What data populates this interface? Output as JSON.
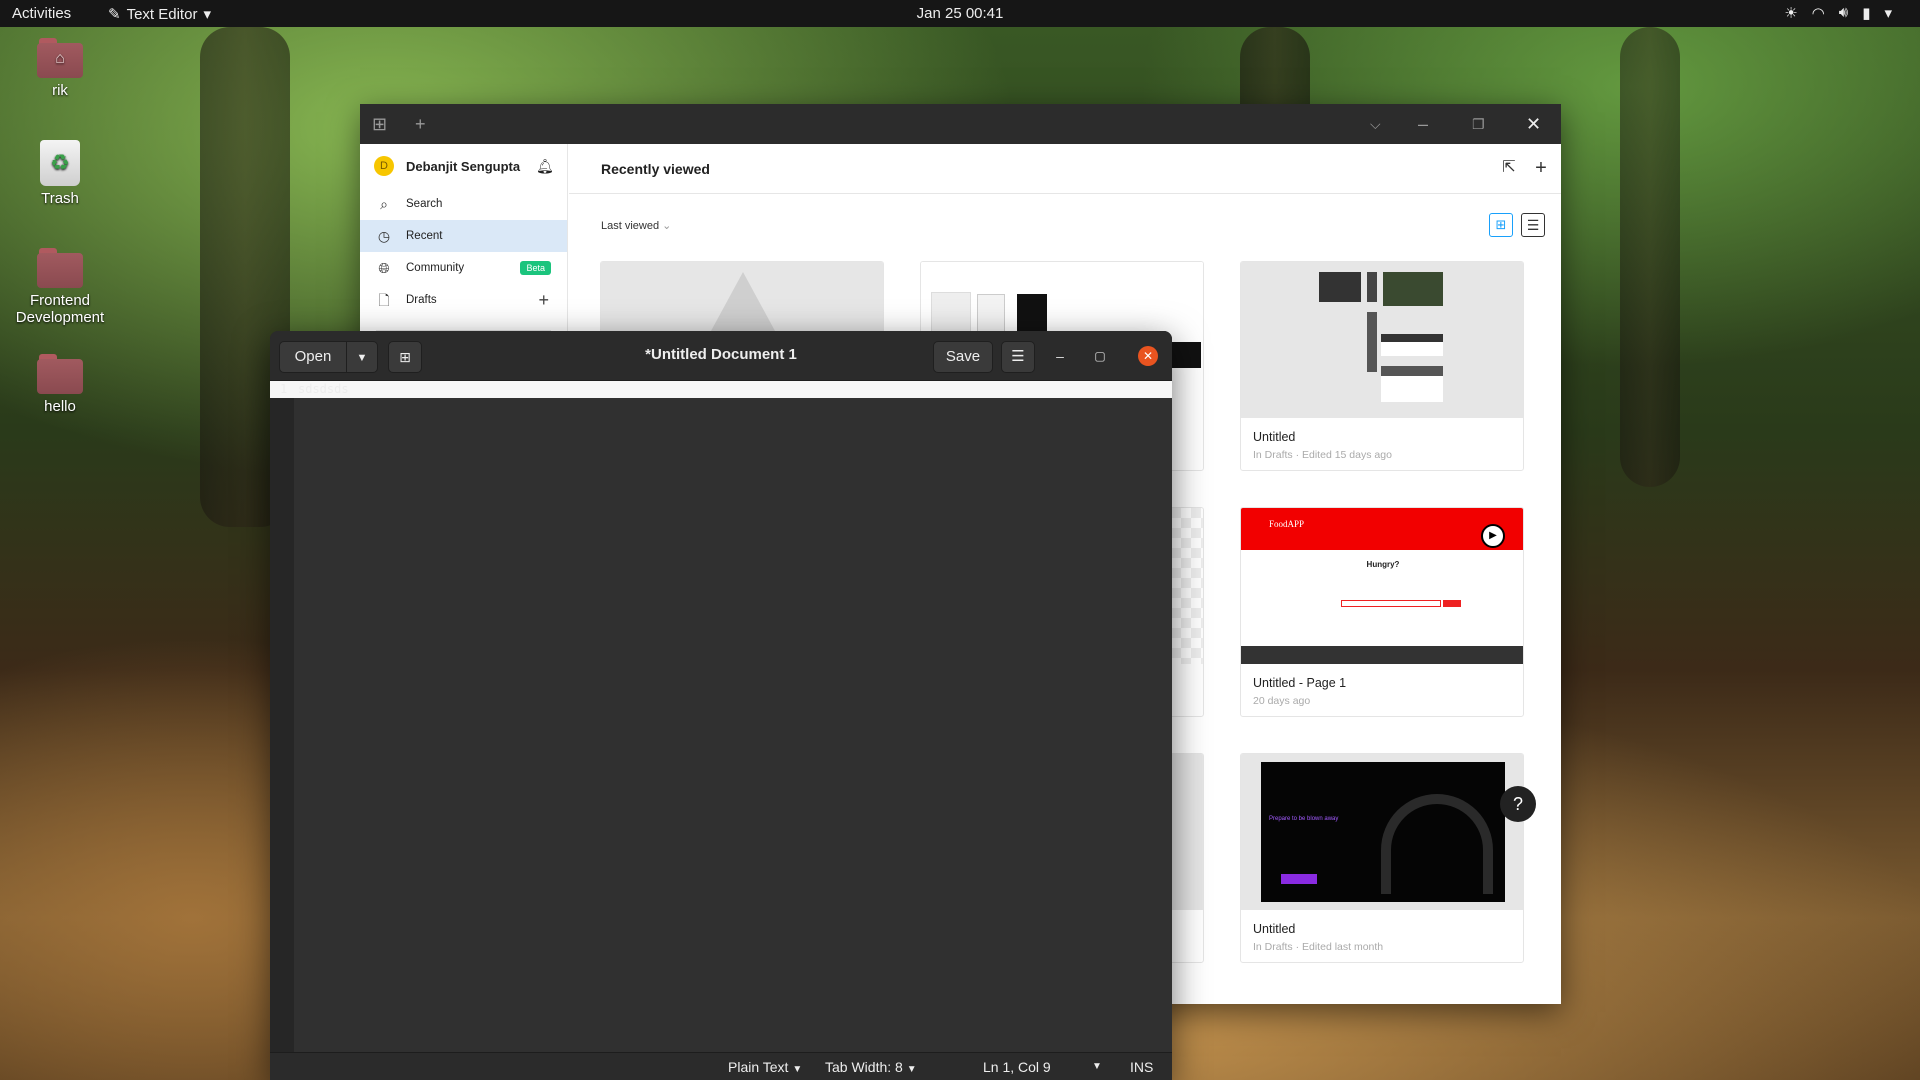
{
  "topbar": {
    "activities": "Activities",
    "app_name": "Text Editor",
    "clock": "Jan 25  00:41"
  },
  "desktop": {
    "icons": [
      {
        "label": "rik"
      },
      {
        "label": "Trash"
      },
      {
        "label": "Frontend Development"
      },
      {
        "label": "hello"
      }
    ]
  },
  "figma": {
    "user_name": "Debanjit Sengupta",
    "avatar_letter": "D",
    "nav": {
      "search": "Search",
      "recent": "Recent",
      "community": "Community",
      "community_badge": "Beta",
      "drafts": "Drafts"
    },
    "page_title": "Recently viewed",
    "sort_label": "Last viewed",
    "cards": [
      {
        "title": "Untitled",
        "subtitle": "In Drafts · Edited 15 days ago"
      },
      {
        "title": "Untitled - Page 1",
        "subtitle": "20 days ago",
        "thumb_brand": "FoodAPP",
        "thumb_heading": "Hungry?"
      },
      {
        "title": "Untitled",
        "subtitle": "In Drafts · Edited last month",
        "thumb_heading": "Prepare to be blown away"
      }
    ],
    "help_label": "?"
  },
  "editor": {
    "open_label": "Open",
    "save_label": "Save",
    "title": "*Untitled Document 1",
    "line_number": "1",
    "line_text": "sdsdsds",
    "status": {
      "language": "Plain Text",
      "tab_width": "Tab Width: 8",
      "position": "Ln 1, Col 9",
      "mode": "INS"
    }
  }
}
